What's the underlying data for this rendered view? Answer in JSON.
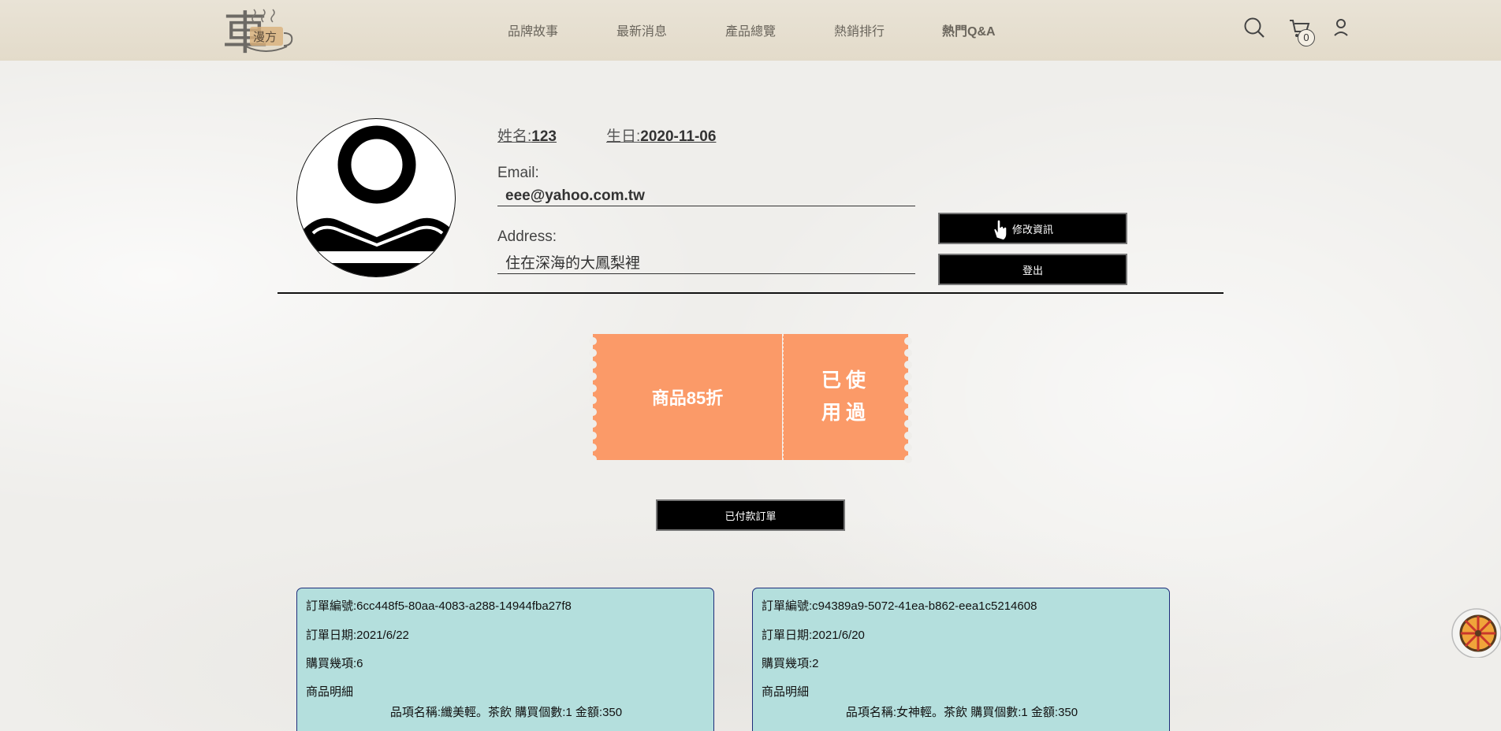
{
  "header": {
    "nav": [
      "品牌故事",
      "最新消息",
      "產品總覽",
      "熱銷排行",
      "熱門Q&A"
    ],
    "cart_count": "0",
    "logo_text": "漫方",
    "logo_char": "車"
  },
  "profile": {
    "name_label": "姓名:",
    "name_value": "123",
    "birthday_label": "生日:",
    "birthday_value": "2020-11-06",
    "email_label": "Email:",
    "email_value": "eee@yahoo.com.tw",
    "address_label": "Address:",
    "address_value": "住在深海的大鳳梨裡",
    "edit_button": "修改資訊",
    "logout_button": "登出"
  },
  "coupon": {
    "title": "商品85折",
    "status_line1": "已使",
    "status_line2": "用過",
    "color": "#fb9a68"
  },
  "paid_orders_button": "已付款訂單",
  "orders": [
    {
      "id": "訂單編號:6cc448f5-80aa-4083-a288-14944fba27f8",
      "date": "訂單日期:2021/6/22",
      "count": "購買幾項:6",
      "details_label": "商品明細",
      "item": "品項名稱:纖美輕。茶飲 購買個數:1 金額:350"
    },
    {
      "id": "訂單編號:c94389a9-5072-41ea-b862-eea1c5214608",
      "date": "訂單日期:2021/6/20",
      "count": "購買幾項:2",
      "details_label": "商品明細",
      "item": "品項名稱:女神輕。茶飲 購買個數:1 金額:350"
    }
  ]
}
